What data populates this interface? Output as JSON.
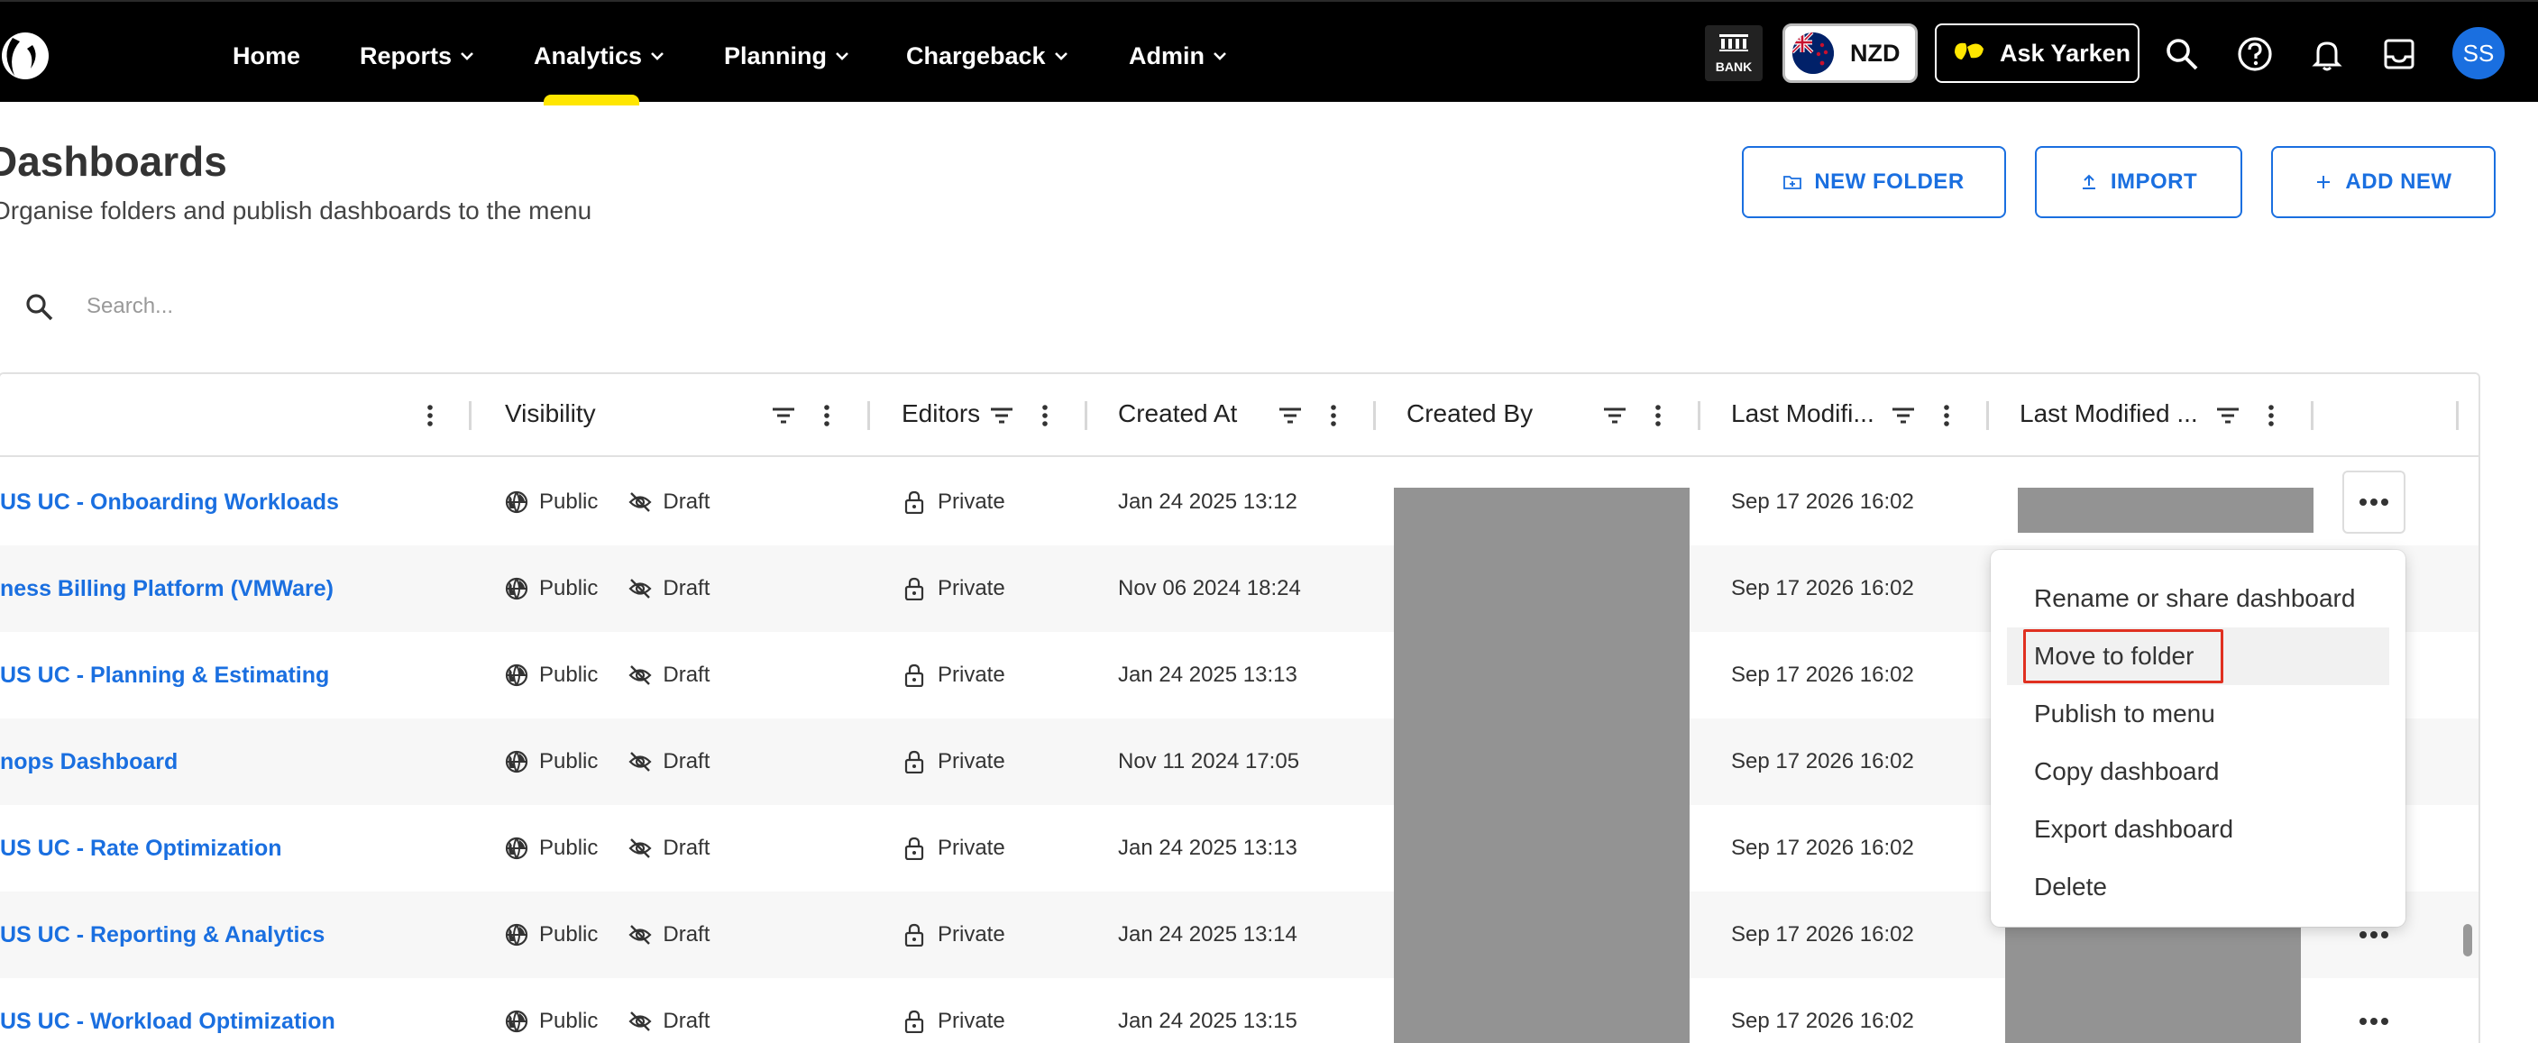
{
  "nav": {
    "items": [
      {
        "label": "Home",
        "has_menu": false
      },
      {
        "label": "Reports",
        "has_menu": true
      },
      {
        "label": "Analytics",
        "has_menu": true,
        "active": true
      },
      {
        "label": "Planning",
        "has_menu": true
      },
      {
        "label": "Chargeback",
        "has_menu": true
      },
      {
        "label": "Admin",
        "has_menu": true
      }
    ],
    "bank_label": "BANK",
    "currency": "NZD",
    "ask_label": "Ask Yarken",
    "avatar_initials": "SS",
    "active_color": "#ffe600"
  },
  "page": {
    "title": "Dashboards",
    "subtitle": "Organise folders and publish dashboards to the menu",
    "buttons": {
      "new_folder": "NEW FOLDER",
      "import": "IMPORT",
      "add_new": "ADD NEW"
    },
    "search_placeholder": "Search...",
    "accent_color": "#1a6fe0"
  },
  "table": {
    "columns": [
      "Visibility",
      "Editors",
      "Created At",
      "Created By",
      "Last Modifi...",
      "Last Modified ..."
    ],
    "rows": [
      {
        "name": "US UC - Onboarding Workloads",
        "visibility": "Public",
        "status": "Draft",
        "editors": "Private",
        "created_at": "Jan 24 2025 13:12",
        "last_modified": "Sep 17 2026 16:02"
      },
      {
        "name": "ness Billing Platform (VMWare)",
        "visibility": "Public",
        "status": "Draft",
        "editors": "Private",
        "created_at": "Nov 06 2024 18:24",
        "last_modified": "Sep 17 2026 16:02"
      },
      {
        "name": "US UC - Planning & Estimating",
        "visibility": "Public",
        "status": "Draft",
        "editors": "Private",
        "created_at": "Jan 24 2025 13:13",
        "last_modified": "Sep 17 2026 16:02"
      },
      {
        "name": "nops Dashboard",
        "visibility": "Public",
        "status": "Draft",
        "editors": "Private",
        "created_at": "Nov 11 2024 17:05",
        "last_modified": "Sep 17 2026 16:02"
      },
      {
        "name": "US UC - Rate Optimization",
        "visibility": "Public",
        "status": "Draft",
        "editors": "Private",
        "created_at": "Jan 24 2025 13:13",
        "last_modified": "Sep 17 2026 16:02"
      },
      {
        "name": "US UC - Reporting & Analytics",
        "visibility": "Public",
        "status": "Draft",
        "editors": "Private",
        "created_at": "Jan 24 2025 13:14",
        "last_modified": "Sep 17 2026 16:02"
      },
      {
        "name": "US UC - Workload Optimization",
        "visibility": "Public",
        "status": "Draft",
        "editors": "Private",
        "created_at": "Jan 24 2025 13:15",
        "last_modified": "Sep 17 2026 16:02"
      }
    ]
  },
  "context_menu": {
    "items": [
      "Rename or share dashboard",
      "Move to folder",
      "Publish to menu",
      "Copy dashboard",
      "Export dashboard",
      "Delete"
    ],
    "highlighted": "Move to folder",
    "highlight_color": "#e03020"
  }
}
